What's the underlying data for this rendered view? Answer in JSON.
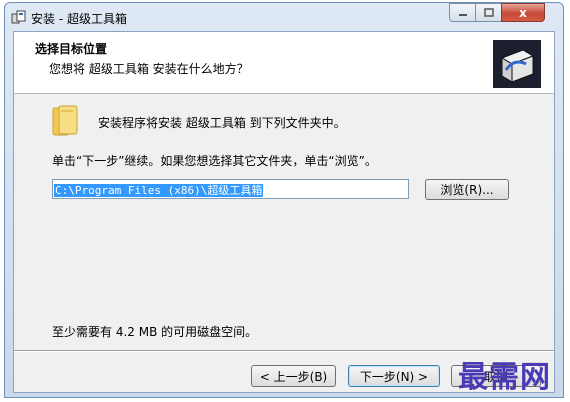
{
  "window": {
    "title": "安装 - 超级工具箱",
    "controls": {
      "close_glyph": "x"
    }
  },
  "header": {
    "title": "选择目标位置",
    "subtitle": "您想将 超级工具箱 安装在什么地方？"
  },
  "body": {
    "intro_text": "安装程序将安装 超级工具箱 到下列文件夹中。",
    "instruction": "单击“下一步”继续。如果您想选择其它文件夹，单击“浏览”。",
    "install_path": "C:\\Program Files (x86)\\超级工具箱",
    "browse_label": "浏览(R)...",
    "disk_space": "至少需要有 4.2 MB 的可用磁盘空间。"
  },
  "footer": {
    "back_label": "< 上一步(B)",
    "next_label": "下一步(N) >",
    "cancel_label": "取消"
  },
  "watermark": "最需网",
  "colors": {
    "close_button": "#c64a3a",
    "selection": "#3399ff",
    "watermark": "#4a3bb4"
  },
  "icons": [
    "setup-app-icon",
    "installer-box-icon",
    "folder-icon"
  ]
}
